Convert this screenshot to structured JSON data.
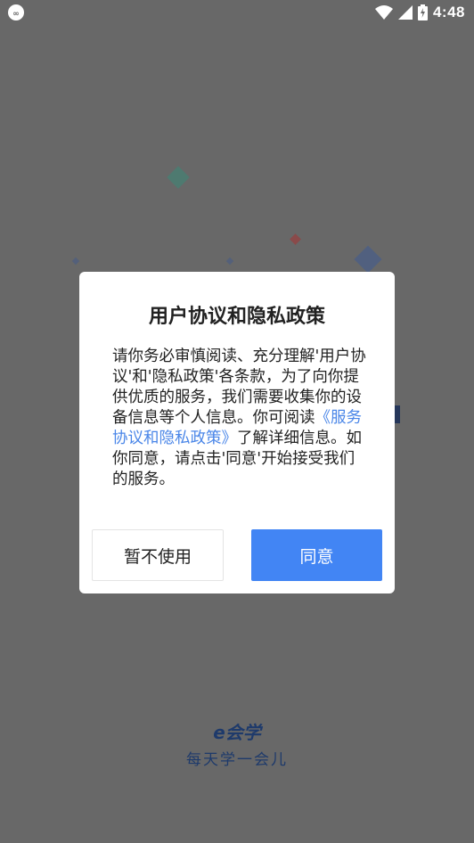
{
  "status_bar": {
    "time": "4:48",
    "left_icon": "app-notification-icon",
    "icons": [
      "wifi-icon",
      "signal-icon",
      "battery-charging-icon"
    ]
  },
  "dialog": {
    "title": "用户协议和隐私政策",
    "body_part1": "请你务必审慎阅读、充分理解'用户协议'和'隐私政策'各条款，为了向你提供优质的服务，我们需要收集你的设备信息等个人信息。你可阅读",
    "link_text": "《服务协议和隐私政策》",
    "body_part2": "了解详细信息。如你同意，请点击'同意'开始接受我们的服务。",
    "decline_label": "暂不使用",
    "agree_label": "同意"
  },
  "brand": {
    "logo": "e会学",
    "slogan": "每天学一会儿"
  },
  "colors": {
    "overlay": "#686868",
    "accent": "#4285f4",
    "link": "#4a86e8",
    "brand": "#1e3a6b"
  }
}
